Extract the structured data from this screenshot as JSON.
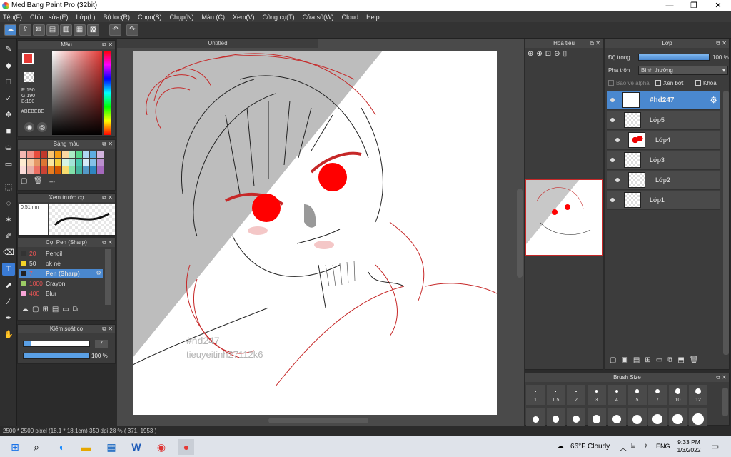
{
  "window": {
    "title": "MediBang Paint Pro (32bit)",
    "minimize": "—",
    "restore": "❐",
    "close": "✕"
  },
  "menu": [
    "Tệp(F)",
    "Chỉnh sửa(E)",
    "Lớp(L)",
    "Bộ lọc(R)",
    "Chọn(S)",
    "Chụp(N)",
    "Màu (C)",
    "Xem(V)",
    "Công cụ(T)",
    "Cửa sổ(W)",
    "Cloud",
    "Help"
  ],
  "color_panel": {
    "title": "Màu",
    "r": "R:190",
    "g": "G:190",
    "b": "B:190",
    "hex": "#BEBEBE"
  },
  "palette_panel": {
    "title": "Bảng màu",
    "more": "---"
  },
  "brush_preview": {
    "title": "Xem trước cọ",
    "size": "0.51mm"
  },
  "brush_panel": {
    "title": "Cọ: Pen (Sharp)",
    "items": [
      {
        "size": "20",
        "name": "Pencil",
        "color": "#333333"
      },
      {
        "size": "50",
        "name": "ok nè",
        "color": "#f5d327"
      },
      {
        "size": "7",
        "name": "Pen (Sharp)",
        "color": "#222222"
      },
      {
        "size": "1000",
        "name": "Crayon",
        "color": "#9ccc65"
      },
      {
        "size": "400",
        "name": "Blur",
        "color": "#f8a5d8"
      }
    ]
  },
  "control_panel": {
    "title": "Kiểm soát cọ",
    "size_value": "7",
    "opacity_value": "100 %",
    "opacity_fraction": 1.0
  },
  "document": {
    "tab": "Untitled",
    "watermark1": "#hd247",
    "watermark2": "tieuyeitinh27112k6"
  },
  "navigator": {
    "title": "Hoa tiêu"
  },
  "layers_panel": {
    "title": "Lớp",
    "opacity_label": "Độ trong",
    "opacity_value": "100 %",
    "blend_label": "Pha trộn",
    "blend_value": "Bình thường",
    "protect_alpha": "Bảo vệ alpha",
    "clipping": "Xén bớt",
    "lock": "Khóa",
    "layers": [
      {
        "name": "#hd247",
        "selected": true
      },
      {
        "name": "Lớp5",
        "selected": false
      },
      {
        "name": "Lớp4",
        "selected": false
      },
      {
        "name": "Lớp3",
        "selected": false
      },
      {
        "name": "Lớp2",
        "selected": false
      },
      {
        "name": "Lớp1",
        "selected": false
      }
    ]
  },
  "brush_size_panel": {
    "title": "Brush Size",
    "sizes": [
      "1",
      "1.5",
      "2",
      "3",
      "4",
      "5",
      "7",
      "10",
      "12"
    ]
  },
  "status": {
    "text": "2500 * 2500 pixel   (18.1 * 18.1cm)   350 dpi   28 %   ( 371, 1953 )"
  },
  "taskbar": {
    "weather": "66°F  Cloudy",
    "lang": "ENG",
    "time": "9:33 PM",
    "date": "1/3/2022"
  },
  "colors": {
    "accent": "#4a88cf",
    "panel": "#3c3c3c",
    "selected_color": "#e53935"
  }
}
